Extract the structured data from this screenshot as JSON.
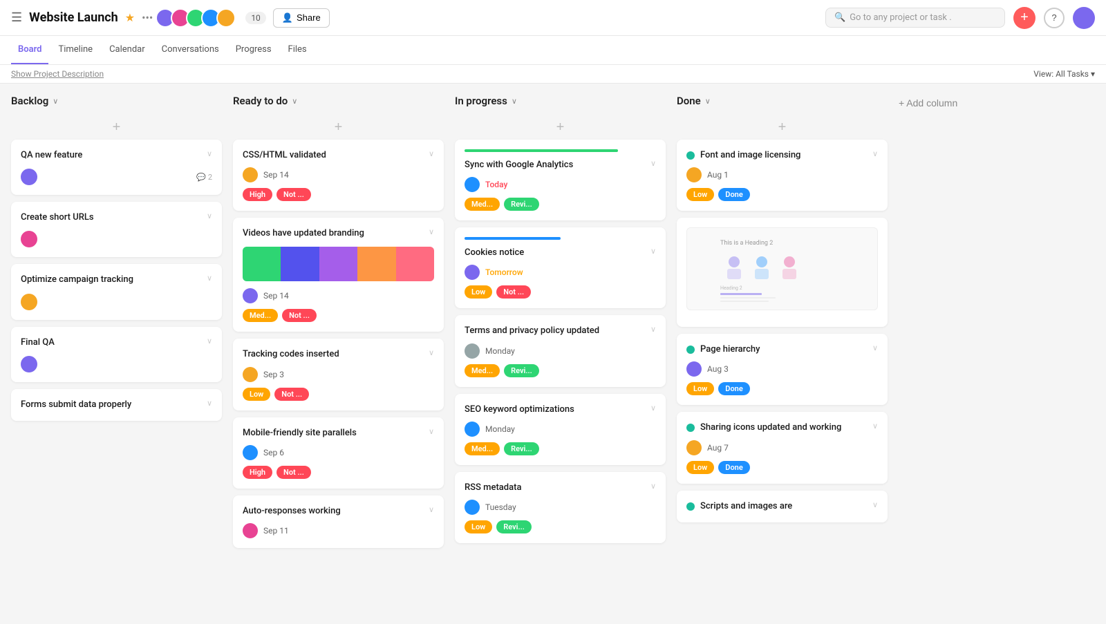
{
  "header": {
    "hamburger": "☰",
    "title": "Website Launch",
    "star": "★",
    "more": "•••",
    "member_count": "10",
    "share_label": "Share",
    "search_placeholder": "Go to any project or task .",
    "add_icon": "+",
    "help_icon": "?"
  },
  "nav": {
    "tabs": [
      "Board",
      "Timeline",
      "Calendar",
      "Conversations",
      "Progress",
      "Files"
    ],
    "active": "Board"
  },
  "toolbar": {
    "show_desc": "Show Project Description",
    "view_all": "View: All Tasks ▾"
  },
  "columns": [
    {
      "id": "backlog",
      "title": "Backlog",
      "cards": [
        {
          "title": "QA new feature",
          "avatar_color": "av-purple",
          "comments": "2",
          "has_comment": true
        },
        {
          "title": "Create short URLs",
          "avatar_color": "av-red"
        },
        {
          "title": "Optimize campaign tracking",
          "avatar_color": "av-orange"
        },
        {
          "title": "Final QA",
          "avatar_color": "av-purple"
        },
        {
          "title": "Forms submit data properly",
          "avatar_color": "av-gray"
        }
      ]
    },
    {
      "id": "ready",
      "title": "Ready to do",
      "cards": [
        {
          "title": "CSS/HTML validated",
          "date": "Sep 14",
          "date_type": "normal",
          "avatar_color": "av-orange",
          "badges": [
            {
              "label": "High",
              "cls": "badge-high"
            },
            {
              "label": "Not ...",
              "cls": "badge-not"
            }
          ]
        },
        {
          "title": "Videos have updated branding",
          "has_gradient": true,
          "date": "Sep 14",
          "date_type": "normal",
          "avatar_color": "av-purple",
          "badges": [
            {
              "label": "Med...",
              "cls": "badge-med"
            },
            {
              "label": "Not ...",
              "cls": "badge-not"
            }
          ]
        },
        {
          "title": "Tracking codes inserted",
          "date": "Sep 3",
          "date_type": "normal",
          "avatar_color": "av-orange",
          "badges": [
            {
              "label": "Low",
              "cls": "badge-low2"
            },
            {
              "label": "Not ...",
              "cls": "badge-not"
            }
          ]
        },
        {
          "title": "Mobile-friendly site parallels",
          "date": "Sep 6",
          "date_type": "normal",
          "avatar_color": "av-blue",
          "badges": [
            {
              "label": "High",
              "cls": "badge-high"
            },
            {
              "label": "Not ...",
              "cls": "badge-not"
            }
          ]
        },
        {
          "title": "Auto-responses working",
          "date": "Sep 11",
          "date_type": "normal",
          "avatar_color": "av-red"
        }
      ]
    },
    {
      "id": "inprogress",
      "title": "In progress",
      "cards": [
        {
          "title": "Sync with Google Analytics",
          "progress": "green",
          "date": "Today",
          "date_type": "today",
          "avatar_color": "av-blue",
          "badges": [
            {
              "label": "Med...",
              "cls": "badge-med"
            },
            {
              "label": "Revi...",
              "cls": "badge-revi"
            }
          ]
        },
        {
          "title": "Cookies notice",
          "progress": "blue",
          "date": "Tomorrow",
          "date_type": "tomorrow",
          "avatar_color": "av-purple",
          "badges": [
            {
              "label": "Low",
              "cls": "badge-low2"
            },
            {
              "label": "Not ...",
              "cls": "badge-not"
            }
          ]
        },
        {
          "title": "Terms and privacy policy updated",
          "date": "Monday",
          "date_type": "normal",
          "avatar_color": "av-gray",
          "badges": [
            {
              "label": "Med...",
              "cls": "badge-med"
            },
            {
              "label": "Revi...",
              "cls": "badge-revi"
            }
          ]
        },
        {
          "title": "SEO keyword optimizations",
          "date": "Monday",
          "date_type": "normal",
          "avatar_color": "av-blue",
          "badges": [
            {
              "label": "Med...",
              "cls": "badge-med"
            },
            {
              "label": "Revi...",
              "cls": "badge-revi"
            }
          ]
        },
        {
          "title": "RSS metadata",
          "date": "Tuesday",
          "date_type": "normal",
          "avatar_color": "av-blue",
          "badges": [
            {
              "label": "Low",
              "cls": "badge-low2"
            },
            {
              "label": "Revi...",
              "cls": "badge-revi"
            }
          ]
        }
      ]
    },
    {
      "id": "done",
      "title": "Done",
      "cards": [
        {
          "title": "Font and image licensing",
          "has_teal_dot": true,
          "date": "Aug 1",
          "date_type": "normal",
          "avatar_color": "av-orange",
          "badges": [
            {
              "label": "Low",
              "cls": "badge-low2"
            },
            {
              "label": "Done",
              "cls": "badge-done"
            }
          ]
        },
        {
          "title": "",
          "has_preview": true
        },
        {
          "title": "Page hierarchy",
          "has_teal_dot": true,
          "date": "Aug 3",
          "date_type": "normal",
          "avatar_color": "av-purple",
          "badges": [
            {
              "label": "Low",
              "cls": "badge-low2"
            },
            {
              "label": "Done",
              "cls": "badge-done"
            }
          ]
        },
        {
          "title": "Sharing icons updated and working",
          "has_teal_dot": true,
          "date": "Aug 7",
          "date_type": "normal",
          "avatar_color": "av-orange",
          "badges": [
            {
              "label": "Low",
              "cls": "badge-low2"
            },
            {
              "label": "Done",
              "cls": "badge-done"
            }
          ]
        },
        {
          "title": "Scripts and images are",
          "has_teal_dot": true,
          "partial": true
        }
      ]
    }
  ],
  "add_column_label": "+ Add column",
  "gradient_colors": [
    "#2ed573",
    "#5352ed",
    "#a55eea",
    "#fd9644",
    "#ff6b81"
  ]
}
